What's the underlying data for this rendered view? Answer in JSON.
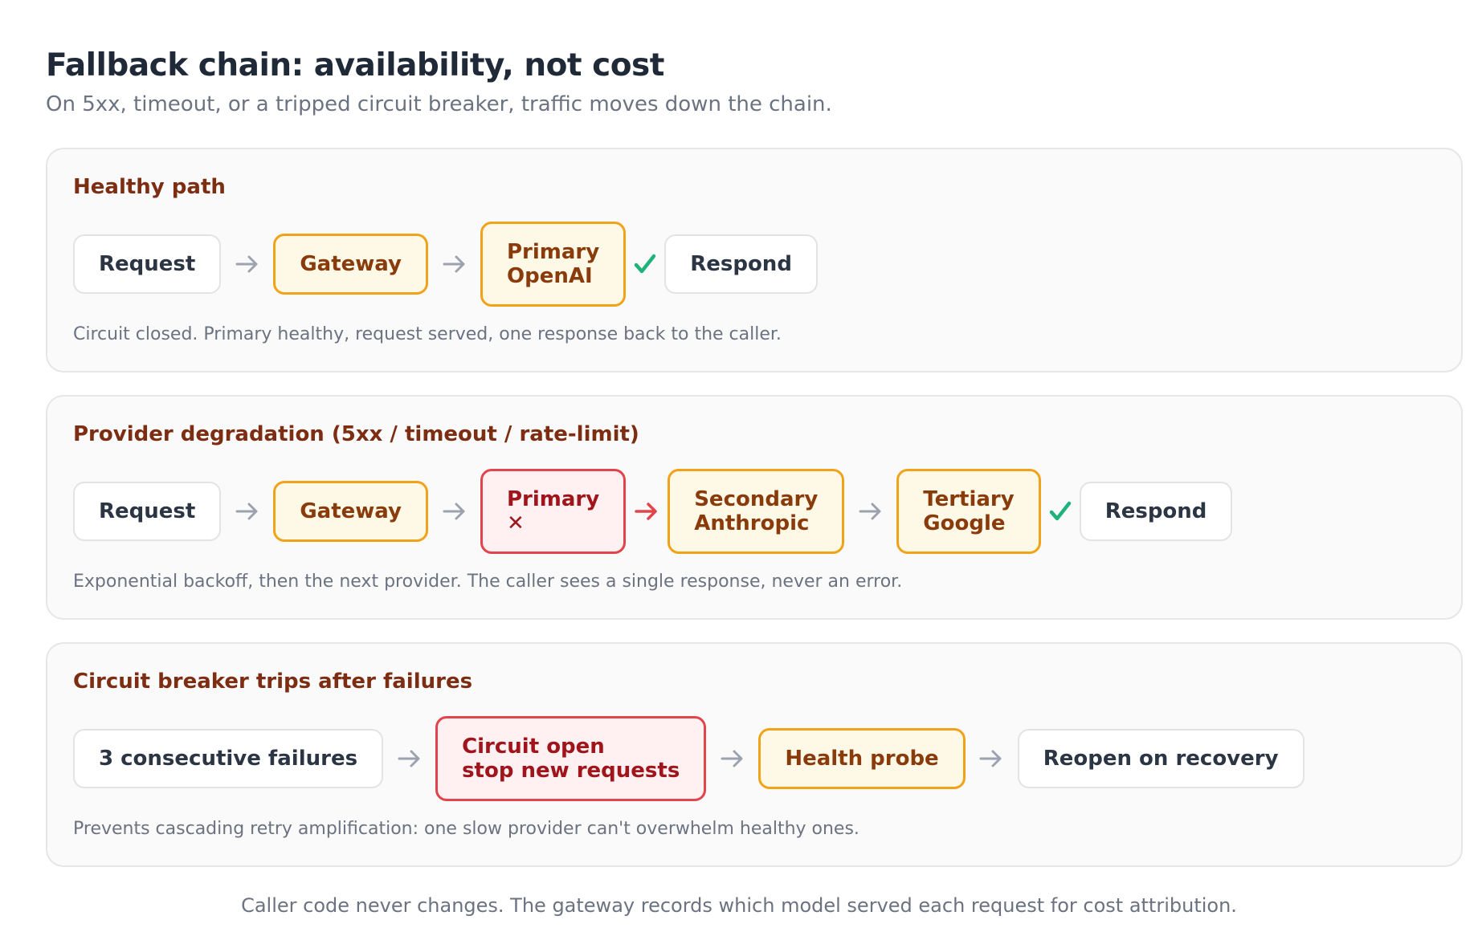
{
  "header": {
    "title": "Fallback chain: availability, not cost",
    "subtitle": "On 5xx, timeout, or a tripped circuit breaker, traffic moves down the chain."
  },
  "panels": [
    {
      "title": "Healthy path",
      "nodes": {
        "request": "Request",
        "gateway": "Gateway",
        "primary_line1": "Primary",
        "primary_line2": "OpenAI",
        "respond": "Respond"
      },
      "note": "Circuit closed. Primary healthy, request served, one response back to the caller."
    },
    {
      "title": "Provider degradation (5xx / timeout / rate-limit)",
      "nodes": {
        "request": "Request",
        "gateway": "Gateway",
        "primary_line1": "Primary",
        "primary_line2": "✕",
        "secondary_line1": "Secondary",
        "secondary_line2": "Anthropic",
        "tertiary_line1": "Tertiary",
        "tertiary_line2": "Google",
        "respond": "Respond"
      },
      "note": "Exponential backoff, then the next provider. The caller sees a single response, never an error."
    },
    {
      "title": "Circuit breaker trips after failures",
      "nodes": {
        "failures": "3 consecutive failures",
        "open_line1": "Circuit open",
        "open_line2": "stop new requests",
        "probe": "Health probe",
        "reopen": "Reopen on recovery"
      },
      "note": "Prevents cascading retry amplification: one slow provider can't overwhelm healthy ones."
    }
  ],
  "footer": "Caller code never changes. The gateway records which model served each request for cost attribution.",
  "colors": {
    "accent_text": "#7c2d12",
    "warn_border": "#f0a319",
    "warn_fill": "#fef9e6",
    "error_border": "#e2444c",
    "error_fill": "#fff0f1",
    "success": "#1fb37b",
    "arrow_neutral": "#9ca3af",
    "arrow_error": "#e2444c"
  },
  "icons": {
    "arrow": "arrow-right-icon",
    "check": "check-icon"
  }
}
